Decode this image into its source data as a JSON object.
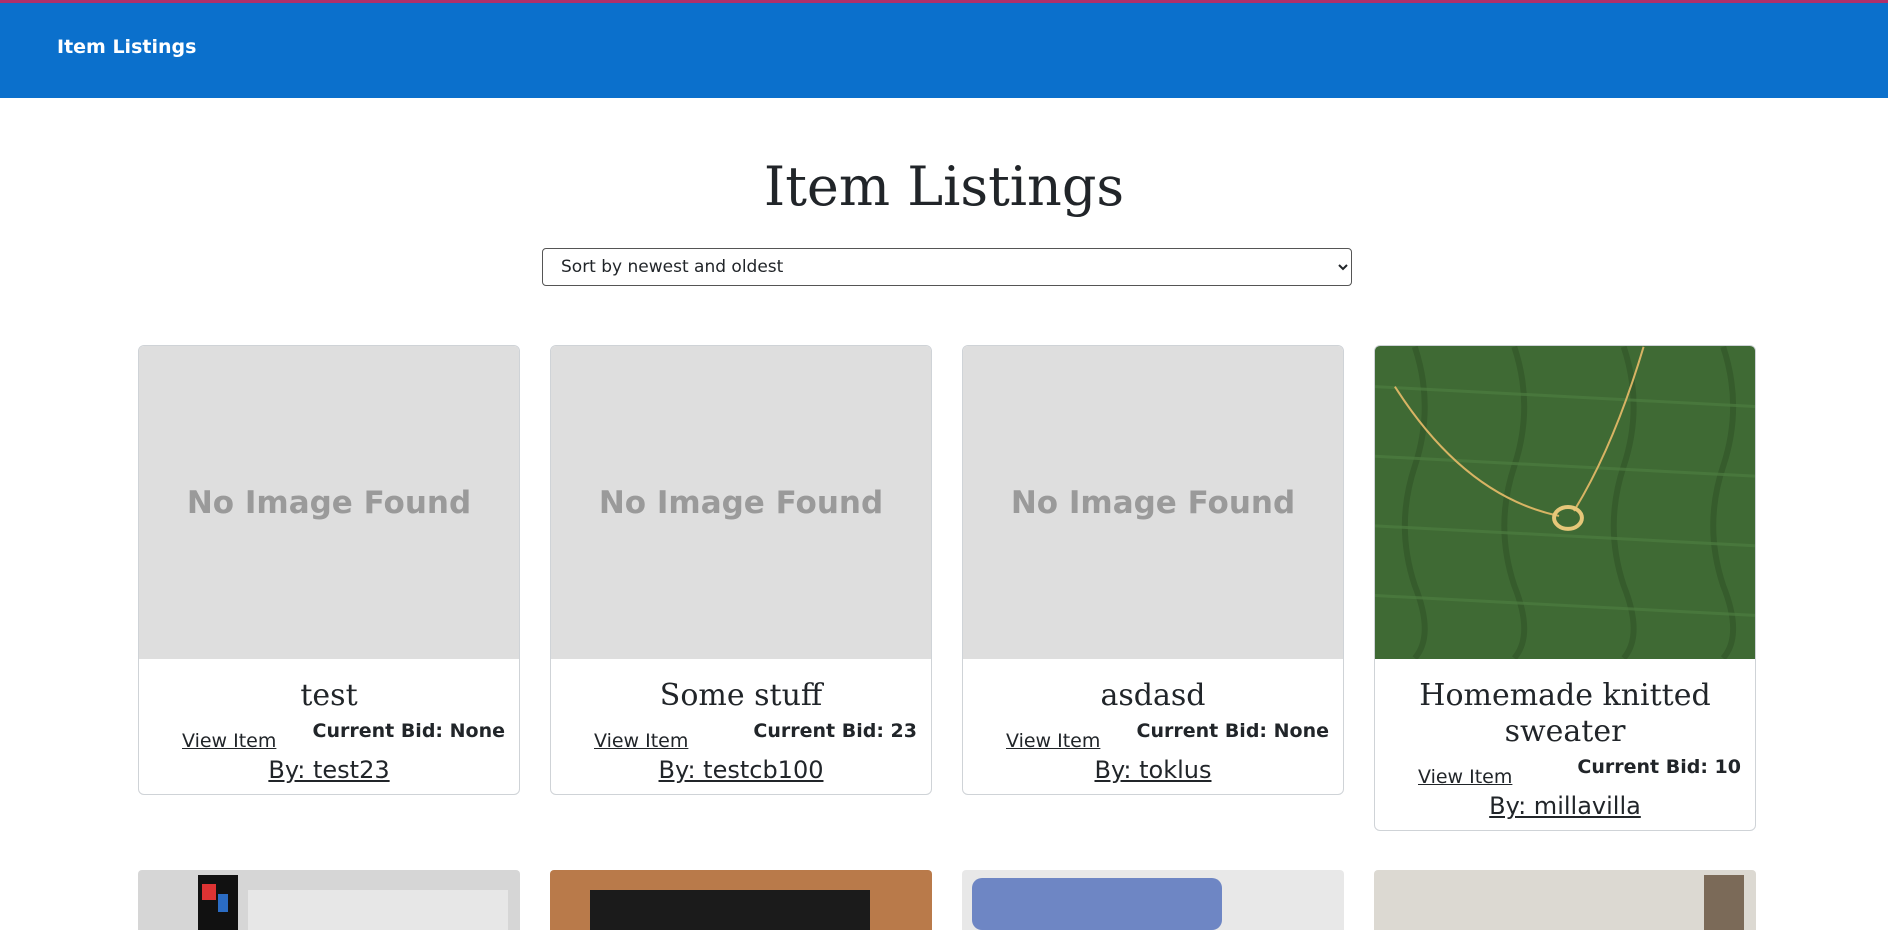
{
  "navbar": {
    "brand": "Item Listings",
    "accent_color": "#0b70cc"
  },
  "page": {
    "title": "Item Listings"
  },
  "sort": {
    "selected": "Sort by newest and oldest"
  },
  "listings": [
    {
      "title": "test",
      "image": "No Image Found",
      "view_label": "View Item",
      "bid_label": "Current Bid: None",
      "by": "By: test23"
    },
    {
      "title": "Some stuff",
      "image": "No Image Found",
      "view_label": "View Item",
      "bid_label": "Current Bid: 23",
      "by": "By: testcb100"
    },
    {
      "title": "asdasd",
      "image": "No Image Found",
      "view_label": "View Item",
      "bid_label": "Current Bid: None",
      "by": "By: toklus"
    },
    {
      "title": "Homemade knitted sweater",
      "image": "sweater-photo",
      "view_label": "View Item",
      "bid_label": "Current Bid: 10",
      "by": "By: millavilla"
    }
  ]
}
